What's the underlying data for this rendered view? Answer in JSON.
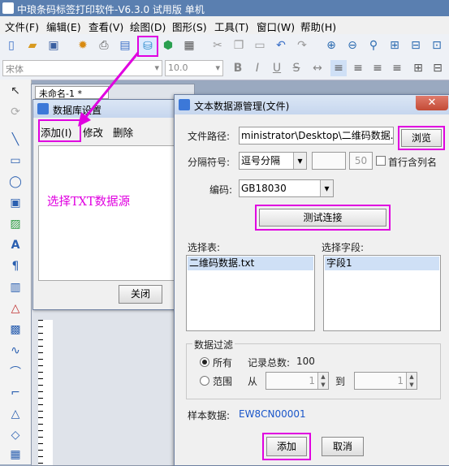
{
  "window": {
    "title": "中琅条码标签打印软件-V6.3.0 试用版 单机"
  },
  "menu": {
    "items": [
      "文件(F)",
      "编辑(E)",
      "查看(V)",
      "绘图(D)",
      "图形(S)",
      "工具(T)",
      "窗口(W)",
      "帮助(H)"
    ]
  },
  "toolbar2": {
    "font_value": "宋体",
    "size_value": "10.0"
  },
  "document": {
    "tab_title": "未命名-1 *"
  },
  "db_dialog": {
    "title": "数据库设置",
    "add_label": "添加(I)",
    "edit_label": "修改",
    "delete_label": "删除",
    "annotation": "选择TXT数据源",
    "close_label": "关闭"
  },
  "main_dialog": {
    "title": "文本数据源管理(文件)",
    "close_glyph": "✕",
    "path_label": "文件路径:",
    "path_value": "ministrator\\Desktop\\二维码数据.txt",
    "browse_label": "浏览",
    "separator_label": "分隔符号:",
    "separator_value": "逗号分隔",
    "first_row_label": "首行含列名",
    "extra_value": "50",
    "encoding_label": "编码:",
    "encoding_value": "GB18030",
    "test_label": "测试连接",
    "select_table_label": "选择表:",
    "table_item": "二维码数据.txt",
    "select_field_label": "选择字段:",
    "field_item": "字段1",
    "filter_label": "数据过滤",
    "all_label": "所有",
    "total_label": "记录总数:",
    "total_value": "100",
    "range_label": "范围",
    "from_label": "从",
    "from_value": "1",
    "to_label": "到",
    "to_value": "1",
    "sample_label": "样本数据:",
    "sample_value": "EW8CN00001",
    "add_label": "添加",
    "cancel_label": "取消"
  },
  "colors": {
    "highlight": "#e000e0",
    "sample_text": "#1a56c9"
  }
}
